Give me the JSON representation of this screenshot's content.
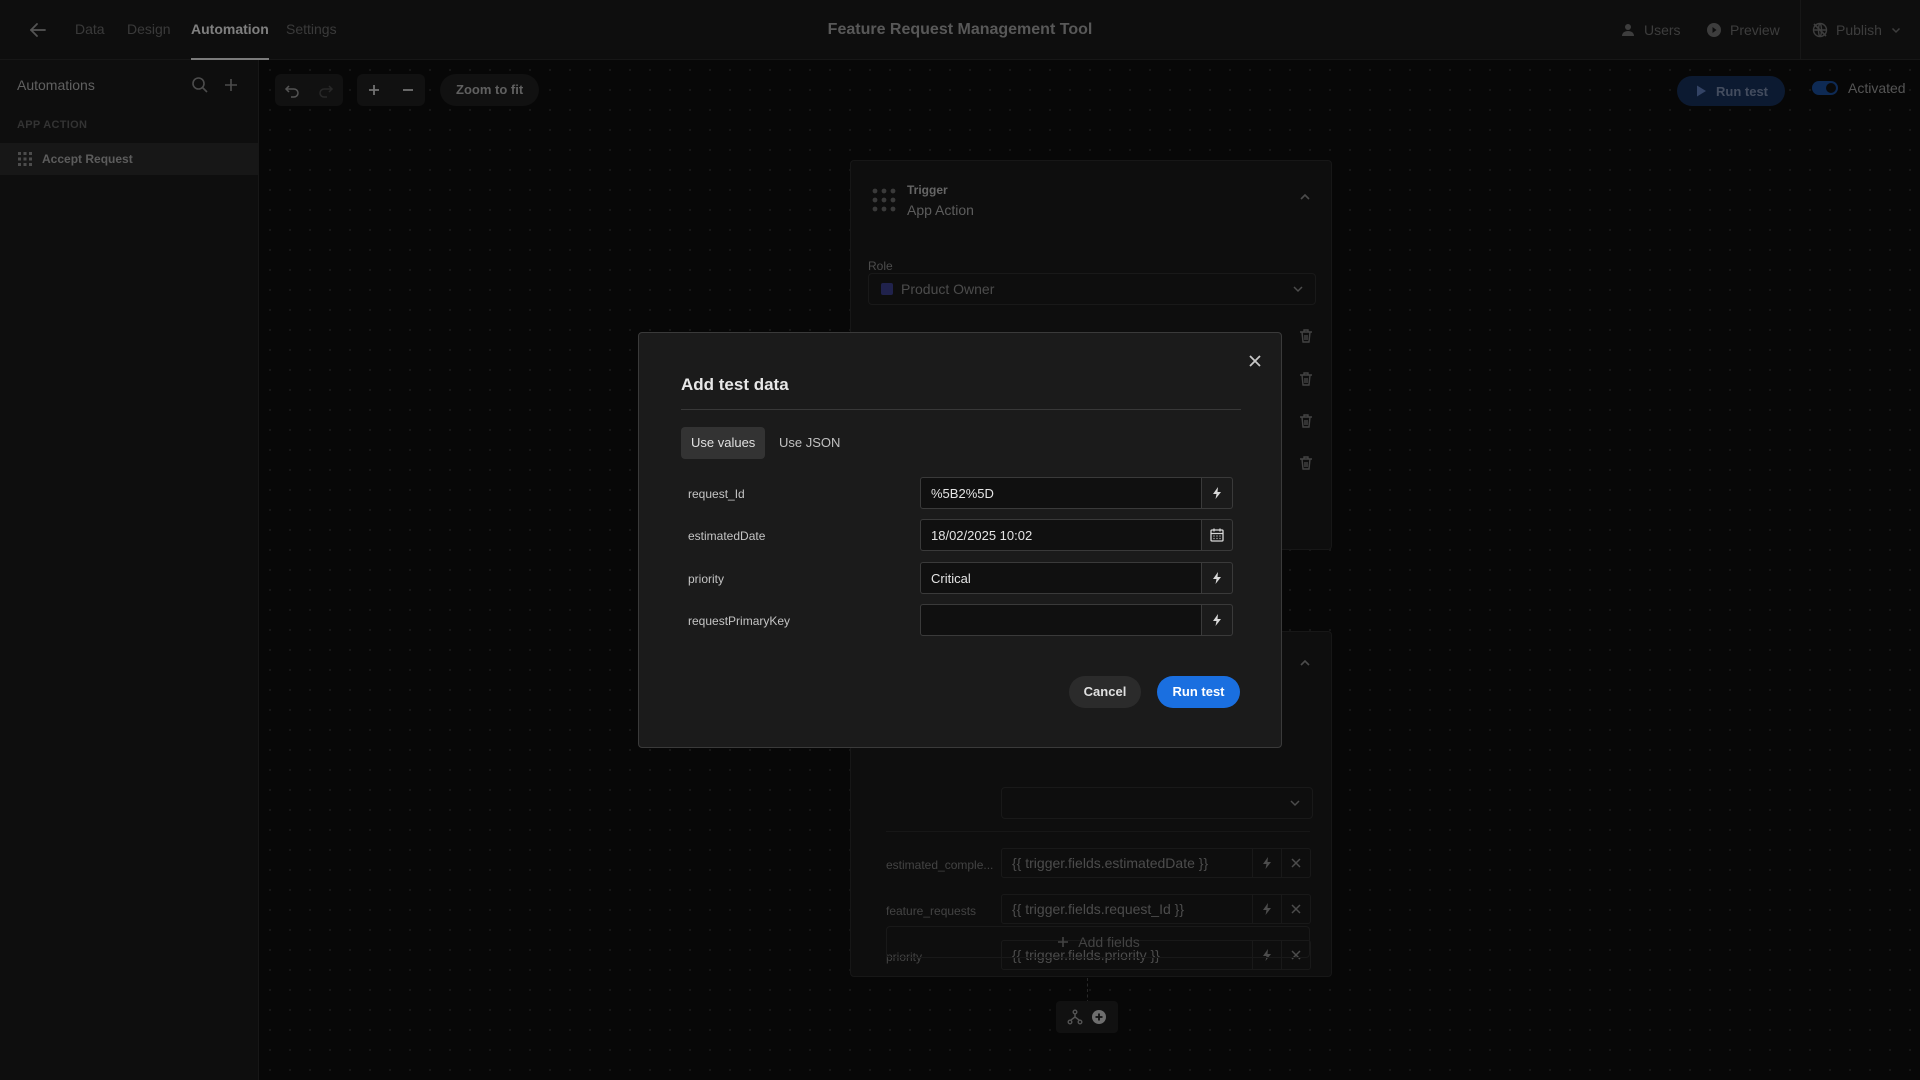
{
  "topbar": {
    "tabs": [
      "Data",
      "Design",
      "Automation",
      "Settings"
    ],
    "active_tab": "Automation",
    "title": "Feature Request Management Tool",
    "users_label": "Users",
    "preview_label": "Preview",
    "publish_label": "Publish"
  },
  "sidebar": {
    "title": "Automations",
    "section": "APP ACTION",
    "items": [
      {
        "label": "Accept Request"
      }
    ]
  },
  "canvas": {
    "zoom_fit_label": "Zoom to fit",
    "run_test_label": "Run test",
    "activated_label": "Activated",
    "activated": true,
    "trigger": {
      "kind": "Trigger",
      "name": "App Action",
      "role_label": "Role",
      "role_value": "Product Owner"
    },
    "step": {
      "fields": [
        {
          "label": "estimated_comple...",
          "value": "{{ trigger.fields.estimatedDate }}"
        },
        {
          "label": "feature_requests",
          "value": "{{ trigger.fields.request_Id }}"
        },
        {
          "label": "priority",
          "value": "{{ trigger.fields.priority }}"
        }
      ],
      "add_fields_label": "Add fields"
    }
  },
  "modal": {
    "title": "Add test data",
    "tabs": [
      {
        "label": "Use values",
        "active": true
      },
      {
        "label": "Use JSON",
        "active": false
      }
    ],
    "fields": [
      {
        "label": "request_Id",
        "value": "%5B2%5D",
        "icon": "lightning-icon"
      },
      {
        "label": "estimatedDate",
        "value": "18/02/2025 10:02",
        "icon": "calendar-icon"
      },
      {
        "label": "priority",
        "value": "Critical",
        "icon": "lightning-icon"
      },
      {
        "label": "requestPrimaryKey",
        "value": "",
        "icon": "lightning-icon"
      }
    ],
    "cancel_label": "Cancel",
    "run_label": "Run test"
  },
  "colors": {
    "accent": "#1a6fe0",
    "role_swatch": "#3b3f8a",
    "background": "#0d0d0d",
    "panel": "#1a1a1a"
  }
}
